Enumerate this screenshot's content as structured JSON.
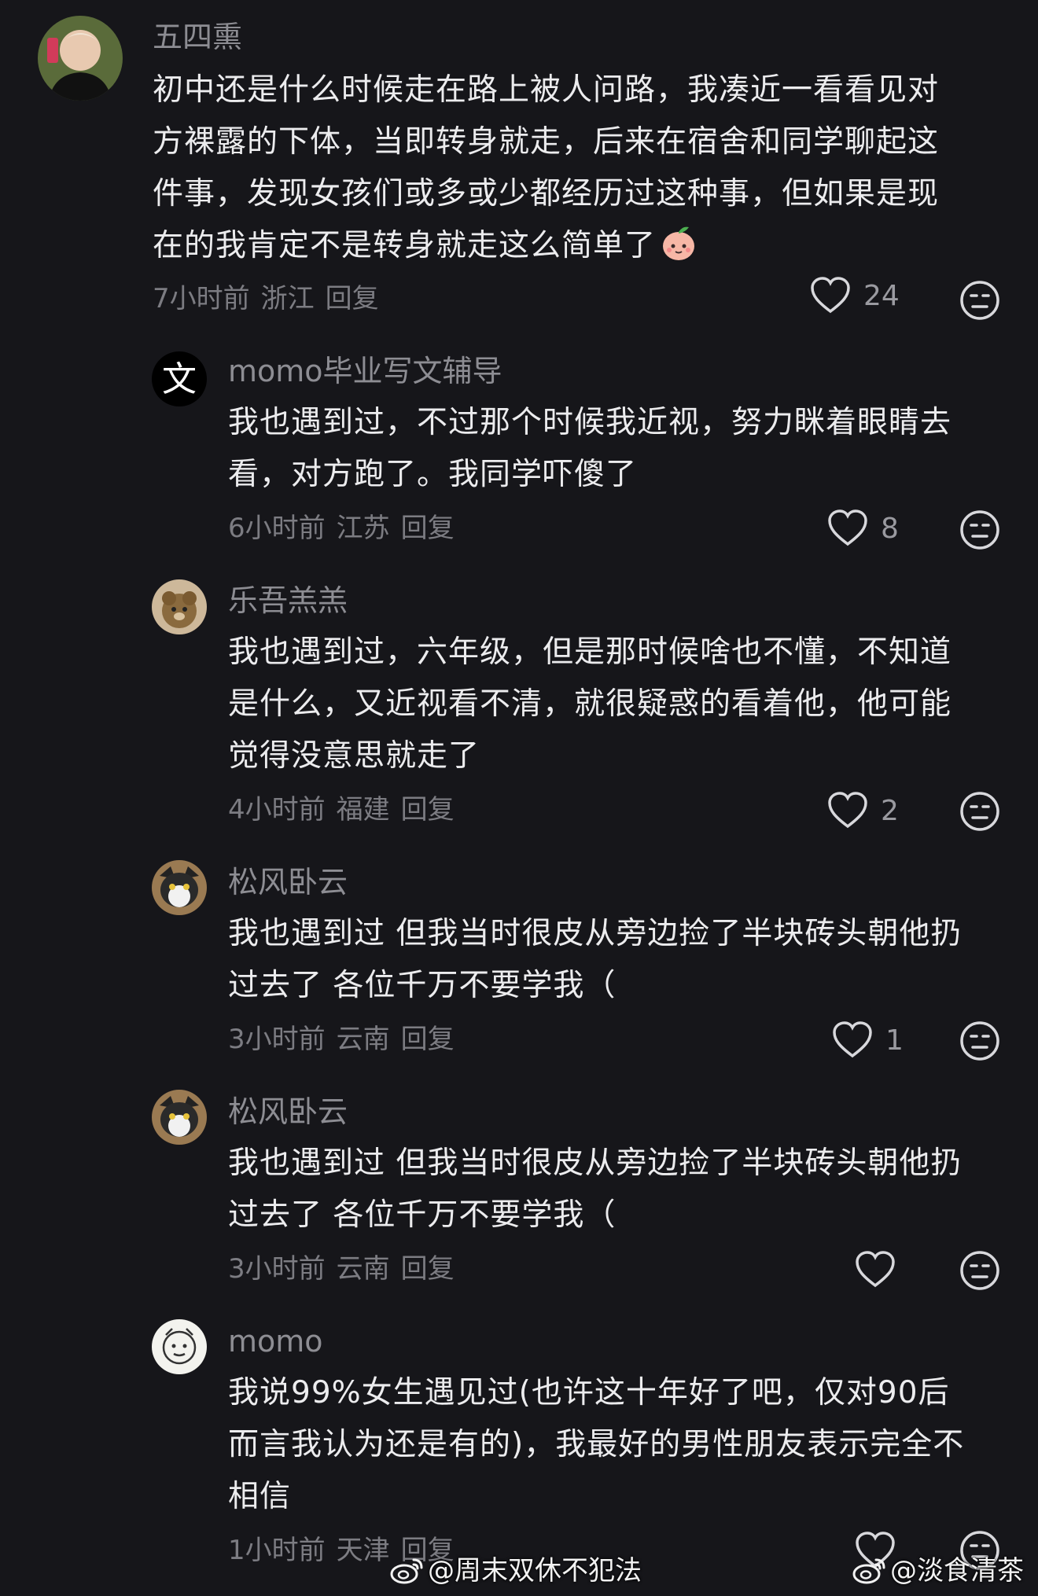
{
  "comments": [
    {
      "username": "五四熏",
      "lines": [
        "初中还是什么时候走在路上被人问路，我凑近一看看见对",
        "方裸露的下体，当即转身就走，后来在宿舍和同学聊起这",
        "件事，发现女孩们或多或少都经历过这种事，但如果是现",
        "在的我肯定不是转身就走这么简单了"
      ],
      "emoji_icon": "peach-face-emoji",
      "time": "7小时前",
      "location": "浙江",
      "reply_label": "回复",
      "likes": "24"
    },
    {
      "username": "momo毕业写文辅导",
      "avatar_text": "文",
      "lines": [
        "我也遇到过，不过那个时候我近视，努力眯着眼睛去",
        "看，对方跑了。我同学吓傻了"
      ],
      "time": "6小时前",
      "location": "江苏",
      "reply_label": "回复",
      "likes": "8"
    },
    {
      "username": "乐吾羔羔",
      "lines": [
        "我也遇到过，六年级，但是那时候啥也不懂，不知道",
        "是什么，又近视看不清，就很疑惑的看着他，他可能",
        "觉得没意思就走了"
      ],
      "time": "4小时前",
      "location": "福建",
      "reply_label": "回复",
      "likes": "2"
    },
    {
      "username": "松风卧云",
      "lines": [
        "我也遇到过 但我当时很皮从旁边捡了半块砖头朝他扔",
        "过去了 各位千万不要学我（"
      ],
      "time": "3小时前",
      "location": "云南",
      "reply_label": "回复",
      "likes": "1"
    },
    {
      "username": "松风卧云",
      "lines": [
        "我也遇到过 但我当时很皮从旁边捡了半块砖头朝他扔",
        "过去了 各位千万不要学我（"
      ],
      "time": "3小时前",
      "location": "云南",
      "reply_label": "回复",
      "likes": ""
    },
    {
      "username": "momo",
      "lines": [
        "我说99%女生遇见过(也许这十年好了吧，仅对90后",
        "而言我认为还是有的)，我最好的男性朋友表示完全不",
        "相信"
      ],
      "time": "1小时前",
      "location": "天津",
      "reply_label": "回复",
      "likes": ""
    }
  ],
  "watermarks": [
    {
      "text": "@周末双休不犯法",
      "icon": "weibo-icon"
    },
    {
      "text": "@淡食清茶",
      "icon": "weibo-icon"
    }
  ],
  "colors": {
    "background": "#16161a",
    "username": "#8d8d93",
    "content": "#ececee",
    "meta": "#7c7c82",
    "icon": "#d8d8dc"
  }
}
